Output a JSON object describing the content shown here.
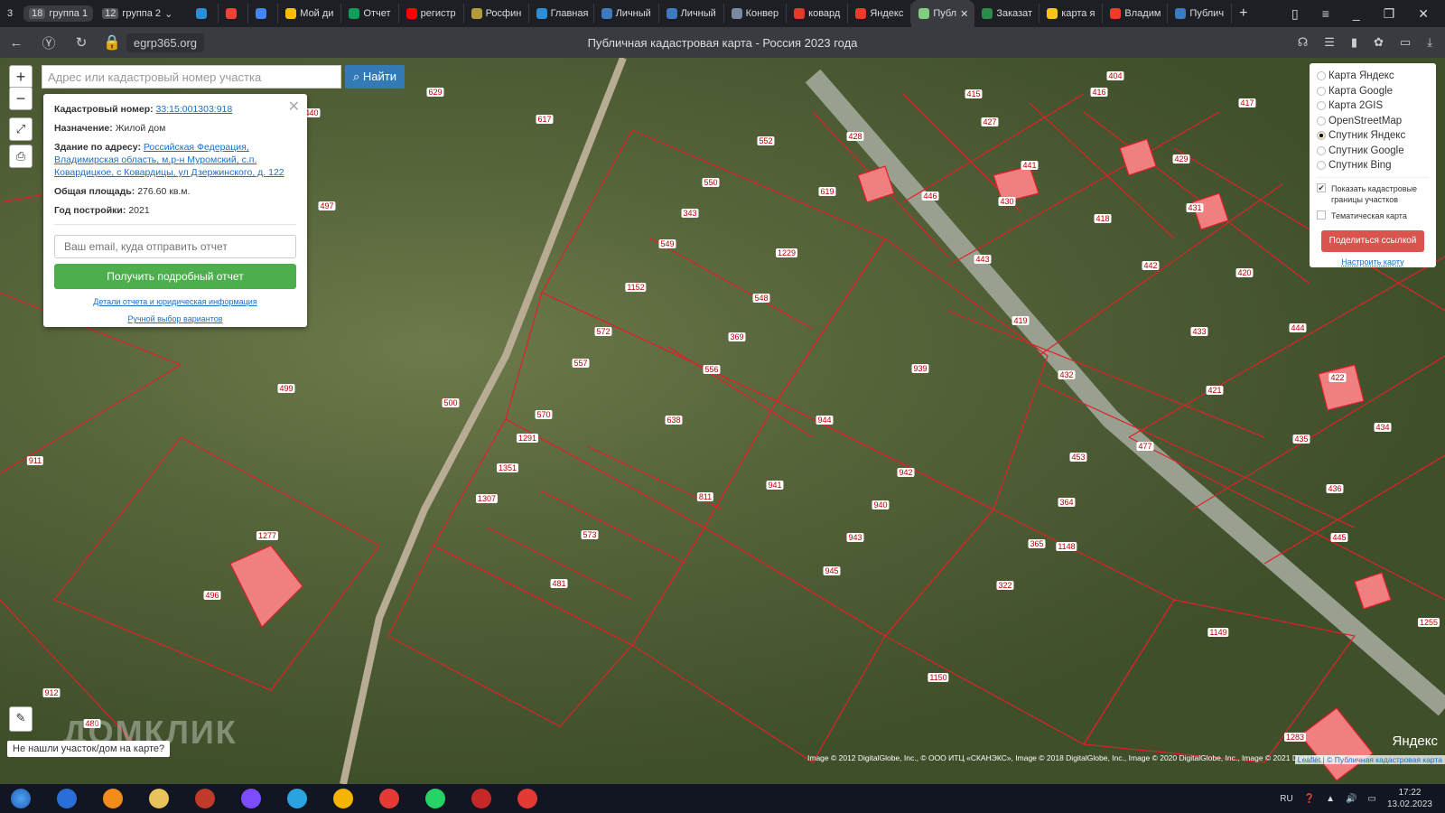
{
  "browser": {
    "tab_count": "3",
    "groups": [
      {
        "count": "18",
        "label": "группа 1"
      },
      {
        "count": "12",
        "label": "группа 2"
      }
    ],
    "tabs": [
      {
        "label": "",
        "color": "#2a8fd8"
      },
      {
        "label": "",
        "color": "#ea4335"
      },
      {
        "label": "",
        "color": "#4285f4"
      },
      {
        "label": "Мой ди",
        "color": "#fbbc04"
      },
      {
        "label": "Отчет",
        "color": "#0f9d58"
      },
      {
        "label": "регистр",
        "color": "#ff0000"
      },
      {
        "label": "Росфин",
        "color": "#b59a3a"
      },
      {
        "label": "Главная",
        "color": "#2a8fd8"
      },
      {
        "label": "Личный",
        "color": "#3b7bbf"
      },
      {
        "label": "Личный",
        "color": "#3b7bbf"
      },
      {
        "label": "Конвер",
        "color": "#7a8aa0"
      },
      {
        "label": "ковард",
        "color": "#e03a2a"
      },
      {
        "label": "Яндекс",
        "color": "#f03a2a"
      },
      {
        "label": "Публ",
        "color": "#7ed07e",
        "active": true
      },
      {
        "label": "Заказат",
        "color": "#2d8a4a"
      },
      {
        "label": "карта я",
        "color": "#f5c518"
      },
      {
        "label": "Владим",
        "color": "#f03a2a"
      },
      {
        "label": "Публич",
        "color": "#3b7bbf"
      }
    ],
    "url": "egrp365.org",
    "page_title": "Публичная кадастровая карта - Россия 2023 года"
  },
  "search": {
    "placeholder": "Адрес или кадастровый номер участка",
    "button": "Найти"
  },
  "popup": {
    "cad_label": "Кадастровый номер:",
    "cad_value": "33:15:001303:918",
    "purpose_label": "Назначение:",
    "purpose_value": "Жилой дом",
    "addr_label": "Здание по адресу:",
    "addr_value": "Российская Федерация, Владимирская область, м.р-н Муромский, с.п. Ковардицкое, с Ковардицы, ул Дзержинского, д. 122",
    "area_label": "Общая площадь:",
    "area_value": "276.60 кв.м.",
    "year_label": "Год постройки:",
    "year_value": "2021",
    "email_placeholder": "Ваш email, куда отправить отчет",
    "get_report": "Получить подробный отчет",
    "details_link": "Детали отчета и юридическая информация",
    "manual_link": "Ручной выбор вариантов"
  },
  "layers": {
    "options": [
      {
        "label": "Карта Яндекс"
      },
      {
        "label": "Карта Google"
      },
      {
        "label": "Карта 2GIS"
      },
      {
        "label": "OpenStreetMap"
      },
      {
        "label": "Спутник Яндекс",
        "selected": true
      },
      {
        "label": "Спутник Google"
      },
      {
        "label": "Спутник Bing"
      }
    ],
    "show_borders": "Показать кадастровые границы участков",
    "show_borders_checked": true,
    "thematic": "Тематическая карта",
    "thematic_checked": false,
    "share": "Поделиться ссылкой",
    "configure": "Настроить карту"
  },
  "map": {
    "parcels": [
      "550",
      "343",
      "549",
      "1229",
      "548",
      "1152",
      "572",
      "369",
      "557",
      "556",
      "570",
      "638",
      "1291",
      "1351",
      "1307",
      "573",
      "811",
      "941",
      "944",
      "942",
      "940",
      "943",
      "945",
      "939",
      "364",
      "365",
      "322",
      "1148",
      "1149",
      "1255",
      "481",
      "1277",
      "496",
      "497",
      "499",
      "500",
      "911",
      "912",
      "480",
      "552",
      "619",
      "629",
      "617",
      "440",
      "428",
      "427",
      "415",
      "416",
      "404",
      "417",
      "429",
      "441",
      "446",
      "430",
      "418",
      "431",
      "442",
      "443",
      "419",
      "420",
      "444",
      "432",
      "433",
      "421",
      "422",
      "434",
      "435",
      "436",
      "445",
      "477",
      "453",
      "1150",
      "1283"
    ],
    "not_found": "Не нашли участок/дом на карте?",
    "watermark": "ДОМКЛИК",
    "yandex_logo": "Яндекс",
    "attribution": "Image © 2012 DigitalGlobe, Inc., © ООО ИТЦ «СКАНЭКС», Image © 2018 DigitalGlobe, Inc., Image © 2020 DigitalGlobe, Inc., Image © 2021 DigitalGlobe, Inc.",
    "leaflet": "Leaflet | © Публичная кадастровая карта"
  },
  "taskbar": {
    "apps": [
      "#2a6fd8",
      "#f28c1a",
      "#e8c25a",
      "#c0392b",
      "#7c4dff",
      "#2aa3e0",
      "#f4b400",
      "#e53935",
      "#25d366",
      "#c62828",
      "#e53935"
    ],
    "lang": "RU",
    "time": "17:22",
    "date": "13.02.2023"
  }
}
